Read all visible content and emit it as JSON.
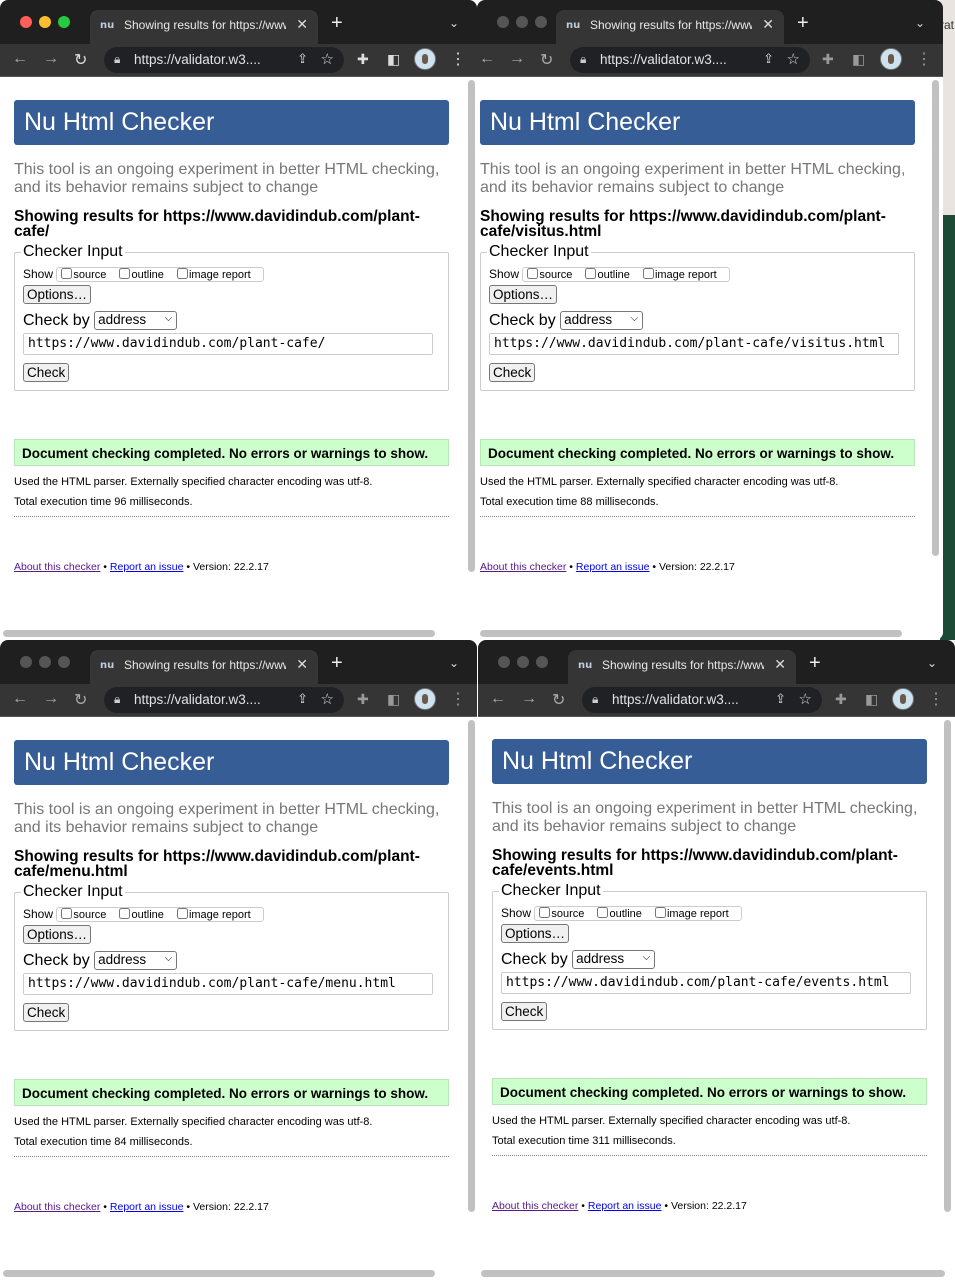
{
  "desktop": {
    "edge_text": "rat"
  },
  "windows": [
    {
      "tab_favicon": "nu",
      "tab_title": "Showing results for https://www.davidindub.com/plant-cafe/",
      "address_bar": "https://validator.w3....",
      "banner": "Nu Html Checker",
      "subtitle": "This tool is an ongoing experiment in better HTML checking, and its behavior remains subject to change",
      "results_heading": "Showing results for https://www.davidindub.com/plant-cafe/",
      "legend": "Checker Input",
      "show_label": "Show",
      "show_options": [
        "source",
        "outline",
        "image report"
      ],
      "options_button": "Options…",
      "check_by_label": "Check by",
      "check_by_value": "address",
      "url_input": "https://www.davidindub.com/plant-cafe/",
      "check_button": "Check",
      "success_message": "Document checking completed. No errors or warnings to show.",
      "parser_info": "Used the HTML parser. Externally specified character encoding was utf-8.",
      "execution_time": "Total execution time 96 milliseconds.",
      "footer": {
        "about": "About this checker",
        "sep1": " • ",
        "report": "Report an issue",
        "version": " • Version: 22.2.17"
      }
    },
    {
      "tab_favicon": "nu",
      "tab_title": "Showing results for https://www.davidindub.com/plant-cafe/visitus.html",
      "address_bar": "https://validator.w3....",
      "banner": "Nu Html Checker",
      "subtitle": "This tool is an ongoing experiment in better HTML checking, and its behavior remains subject to change",
      "results_heading": "Showing results for https://www.davidindub.com/plant-cafe/visitus.html",
      "legend": "Checker Input",
      "show_label": "Show",
      "show_options": [
        "source",
        "outline",
        "image report"
      ],
      "options_button": "Options…",
      "check_by_label": "Check by",
      "check_by_value": "address",
      "url_input": "https://www.davidindub.com/plant-cafe/visitus.html",
      "check_button": "Check",
      "success_message": "Document checking completed. No errors or warnings to show.",
      "parser_info": "Used the HTML parser. Externally specified character encoding was utf-8.",
      "execution_time": "Total execution time 88 milliseconds.",
      "footer": {
        "about": "About this checker",
        "sep1": " • ",
        "report": "Report an issue",
        "version": " • Version: 22.2.17"
      }
    },
    {
      "tab_favicon": "nu",
      "tab_title": "Showing results for https://www.davidindub.com/plant-cafe/menu.html",
      "address_bar": "https://validator.w3....",
      "banner": "Nu Html Checker",
      "subtitle": "This tool is an ongoing experiment in better HTML checking, and its behavior remains subject to change",
      "results_heading": "Showing results for https://www.davidindub.com/plant-cafe/menu.html",
      "legend": "Checker Input",
      "show_label": "Show",
      "show_options": [
        "source",
        "outline",
        "image report"
      ],
      "options_button": "Options…",
      "check_by_label": "Check by",
      "check_by_value": "address",
      "url_input": "https://www.davidindub.com/plant-cafe/menu.html",
      "check_button": "Check",
      "success_message": "Document checking completed. No errors or warnings to show.",
      "parser_info": "Used the HTML parser. Externally specified character encoding was utf-8.",
      "execution_time": "Total execution time 84 milliseconds.",
      "footer": {
        "about": "About this checker",
        "sep1": " • ",
        "report": "Report an issue",
        "version": " • Version: 22.2.17"
      }
    },
    {
      "tab_favicon": "nu",
      "tab_title": "Showing results for https://www.davidindub.com/plant-cafe/events.html",
      "address_bar": "https://validator.w3....",
      "banner": "Nu Html Checker",
      "subtitle": "This tool is an ongoing experiment in better HTML checking, and its behavior remains subject to change",
      "results_heading": "Showing results for https://www.davidindub.com/plant-cafe/events.html",
      "legend": "Checker Input",
      "show_label": "Show",
      "show_options": [
        "source",
        "outline",
        "image report"
      ],
      "options_button": "Options…",
      "check_by_label": "Check by",
      "check_by_value": "address",
      "url_input": "https://www.davidindub.com/plant-cafe/events.html",
      "check_button": "Check",
      "success_message": "Document checking completed. No errors or warnings to show.",
      "parser_info": "Used the HTML parser. Externally specified character encoding was utf-8.",
      "execution_time": "Total execution time 311 milliseconds.",
      "footer": {
        "about": "About this checker",
        "sep1": " • ",
        "report": "Report an issue",
        "version": " • Version: 22.2.17"
      }
    }
  ],
  "colors": {
    "banner": "#365d95",
    "success_bg": "#ccffcc",
    "link": "#0000ee",
    "visited_link": "#551a8b",
    "traffic_close": "#ff5f57",
    "traffic_min": "#febc2e",
    "traffic_max": "#28c840"
  },
  "icons": [
    "tab-close-icon",
    "new-tab-icon",
    "back-arrow-icon",
    "forward-arrow-icon",
    "reload-icon",
    "lock-icon",
    "share-icon",
    "bookmark-star-icon",
    "extensions-puzzle-icon",
    "side-panel-icon",
    "profile-avatar-icon",
    "menu-kebab-icon",
    "tab-search-chevron-icon",
    "dropdown-chevron-icon"
  ]
}
